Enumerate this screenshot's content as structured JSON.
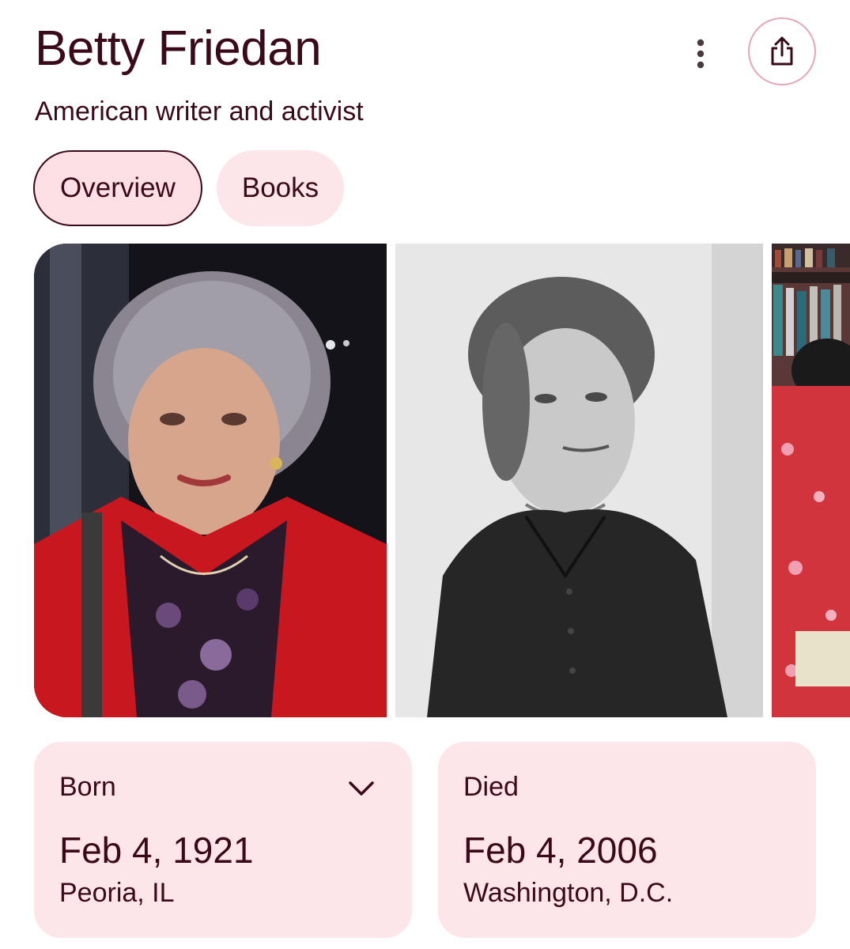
{
  "header": {
    "title": "Betty Friedan",
    "subtitle": "American writer and activist",
    "more_icon": "more-vert-icon",
    "share_icon": "share-icon"
  },
  "tabs": [
    {
      "label": "Overview",
      "active": true
    },
    {
      "label": "Books",
      "active": false
    }
  ],
  "gallery": {
    "images": [
      {
        "kind": "color-portrait"
      },
      {
        "kind": "black-and-white-portrait"
      },
      {
        "kind": "color-portrait-cropped"
      }
    ]
  },
  "facts": {
    "born": {
      "label": "Born",
      "date": "Feb 4, 1921",
      "place": "Peoria, IL",
      "expand_icon": "chevron-down-icon"
    },
    "died": {
      "label": "Died",
      "date": "Feb 4, 2006",
      "place": "Washington, D.C."
    }
  },
  "colors": {
    "text": "#3b0a1a",
    "chip_bg": "#fde6ea",
    "share_border": "#e5a7b4"
  }
}
